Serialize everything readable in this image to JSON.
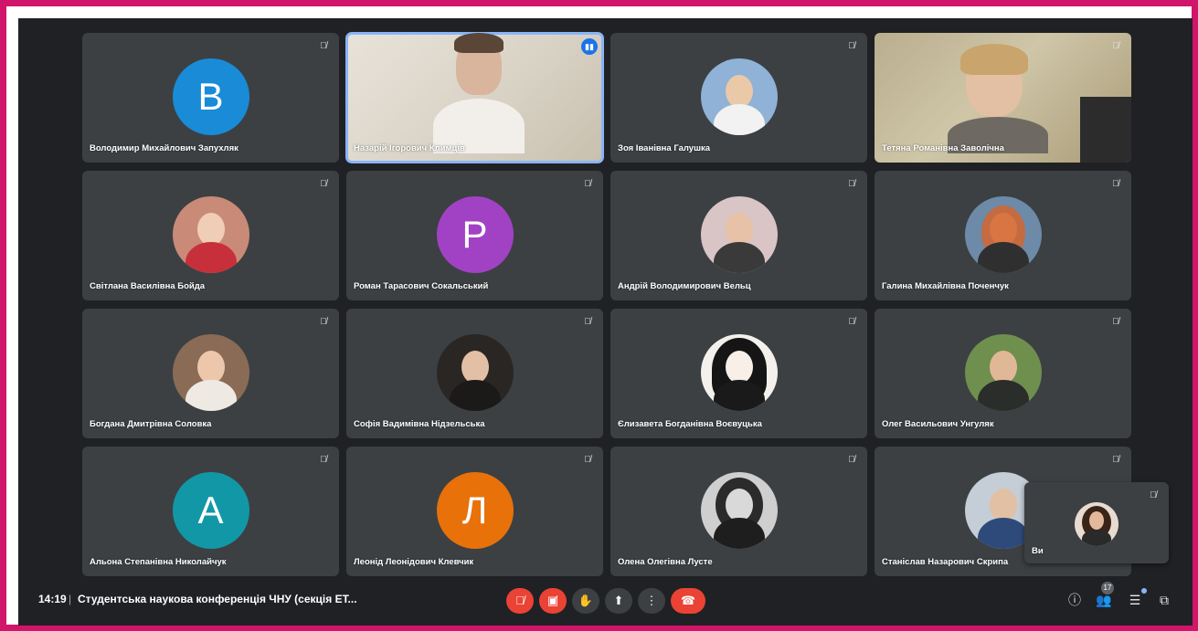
{
  "meeting": {
    "time": "14:19",
    "separator": "|",
    "title": "Студентська наукова конференція ЧНУ (секція ЕТ..."
  },
  "participants": [
    {
      "name": "Володимир Михайлович Запухляк",
      "initial": "В",
      "color": "#1a8bd6",
      "kind": "letter"
    },
    {
      "name": "Назарій Ігорович Климців",
      "kind": "video",
      "speaking": true
    },
    {
      "name": "Зоя Іванівна Галушка",
      "kind": "photo"
    },
    {
      "name": "Тетяна Романівна Заволічна",
      "kind": "video"
    },
    {
      "name": "Світлана Василівна Бойда",
      "kind": "photo"
    },
    {
      "name": "Роман Тарасович Сокальський",
      "initial": "Р",
      "color": "#a142c4",
      "kind": "letter"
    },
    {
      "name": "Андрій Володимирович Вельц",
      "kind": "photo"
    },
    {
      "name": "Галина Михайлівна Поченчук",
      "kind": "photo"
    },
    {
      "name": "Богдана Дмитрівна Соловка",
      "kind": "photo"
    },
    {
      "name": "Софія Вадимівна Нідзельська",
      "kind": "photo"
    },
    {
      "name": "Єлизавета Богданівна Воєвуцька",
      "kind": "photo"
    },
    {
      "name": "Олег Васильович Унгуляк",
      "kind": "photo"
    },
    {
      "name": "Альона Степанівна Николайчук",
      "initial": "А",
      "color": "#1297a7",
      "kind": "letter"
    },
    {
      "name": "Леонід Леонідович Клевчик",
      "initial": "Л",
      "color": "#e8710a",
      "kind": "letter"
    },
    {
      "name": "Олена Олегівна Лусте",
      "kind": "photo"
    },
    {
      "name": "Станіслав Назарович Скрипа",
      "kind": "photo"
    }
  ],
  "self": {
    "name": "Ви"
  },
  "toolbar": {
    "participants_count": "17"
  },
  "icons": {
    "mic_off": "mic-off-icon",
    "cam_off": "camera-off-icon",
    "raise_hand": "raise-hand-icon",
    "present": "present-screen-icon",
    "more": "more-options-icon",
    "hangup": "hang-up-icon",
    "info": "info-icon",
    "people": "people-icon",
    "chat": "chat-icon",
    "activities": "activities-icon"
  }
}
